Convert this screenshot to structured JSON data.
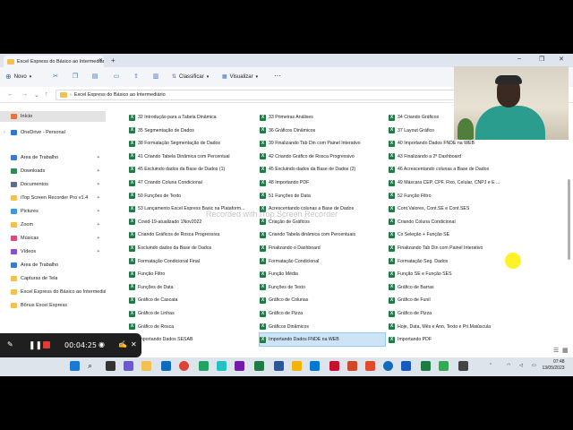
{
  "window": {
    "tab_title": "Excel Express do Básico ao Intermediário",
    "tab_close": "✕",
    "tab_add": "+"
  },
  "toolbar": {
    "new_label": "Novo",
    "sort_label": "Classificar",
    "view_label": "Visualizar",
    "more_label": "···"
  },
  "address": {
    "path": "Excel Express do Básico ao Intermediário"
  },
  "sidebar": {
    "items": [
      {
        "label": "Início",
        "color": "#e8743b",
        "pinned": false
      },
      {
        "label": "OneDrive - Personal",
        "color": "#2b78d0",
        "pinned": false
      },
      {
        "label": "Área de Trabalho",
        "color": "#3a7bd5",
        "pinned": true
      },
      {
        "label": "Downloads",
        "color": "#2e8b57",
        "pinned": true
      },
      {
        "label": "Documentos",
        "color": "#5a6b8c",
        "pinned": true
      },
      {
        "label": "iTop Screen Recorder Pro v1.4",
        "color": "#f2c14e",
        "pinned": true
      },
      {
        "label": "Pictures",
        "color": "#3a9ad9",
        "pinned": true
      },
      {
        "label": "Zoom",
        "color": "#f2c14e",
        "pinned": true
      },
      {
        "label": "Músicas",
        "color": "#e0457b",
        "pinned": true
      },
      {
        "label": "Vídeos",
        "color": "#8a4fd6",
        "pinned": true
      },
      {
        "label": "Área de Trabalho",
        "color": "#3a7bd5",
        "pinned": false
      },
      {
        "label": "Capturas de Tela",
        "color": "#f2c14e",
        "pinned": false
      },
      {
        "label": "Excel Express do Básico ao Intermediário",
        "color": "#f2c14e",
        "pinned": false
      },
      {
        "label": "Bônus Excel Express",
        "color": "#f2c14e",
        "pinned": false
      }
    ]
  },
  "files": {
    "col1": [
      "32 Introdução para a Tabela Dinâmica",
      "35 Segmentação de Dados",
      "38 Formatação Segmentação de Dados",
      "41 Criando Tabela Dinâmica com Percentual",
      "45 Excluindo dados da Base de Dados (1)",
      "47 Criando Coluna Condicional",
      "50 Funções de Texto",
      "53 Lançamento Excel Express Basic na Plataform...",
      "Covid-19-atualizado 1Nov2022",
      "Criando Gráficos de Rosca Progressiva",
      "Excluindo dados da Base de Dados",
      "Formatação Condicional Final",
      "Função Filtro",
      "Funções de Data",
      "Gráfico de Cascata",
      "Gráfico de Linhas",
      "Gráfico de Rosca",
      "Importando Dados SESAB"
    ],
    "col2": [
      "33 Primeiras Análises",
      "36 Gráficos Dinâmicos",
      "39 Finalizando Tab Din com Painel Interativo",
      "42 Criando Gráfico de Rosca Progressivo",
      "45 Excluindo dados da Base de Dados (2)",
      "48 Importando PDF",
      "51 Funções de Data",
      "Acrescentando colunas a Base de Dados",
      "Criação de Gráficos",
      "Criando Tabela dinâmica com Percentuais",
      "Finalizando o Dashboard",
      "Formatação Condicional",
      "Função Média",
      "Funções de Texto",
      "Gráfico de Colunas",
      "Gráfico de Pizza",
      "Gráficos Dinâmicos",
      "Importando Dados FNDE na WEB"
    ],
    "col3": [
      "34 Criando Gráficos",
      "37 Layout Gráfico",
      "40 Importando Dados FNDE na WEB",
      "43 Finalizando a 2ª Dashboard",
      "46 Acrescentando colunas a Base de Dados",
      "49 Máscara CEP, CPF, Fixo, Celular, CNPJ e E ...",
      "52 Função Filtro",
      "Cont.Valores, Cont.SE e Cont.SES",
      "Criando Coluna Condicional",
      "Cx Seleção + Função SE",
      "Finalizando Tab Din com Painel Interativo",
      "Formatação Seg. Dados",
      "Função SE e Função SES",
      "Gráfico de Barras",
      "Gráfico de Funil",
      "Gráfico de Pizza",
      "Hoje, Data, Mês e Ano, Texto e Pri.Maiúscula",
      "Importando PDF"
    ]
  },
  "watermark": "Recorded with iTop Screen Recorder",
  "recorder": {
    "time": "00:04:25"
  },
  "clock": {
    "time": "07:48",
    "date": "13/05/2023"
  },
  "colors": {
    "excel_green": "#1d7c45",
    "selection": "#cce4f7",
    "taskbar": "#dde4ec"
  }
}
